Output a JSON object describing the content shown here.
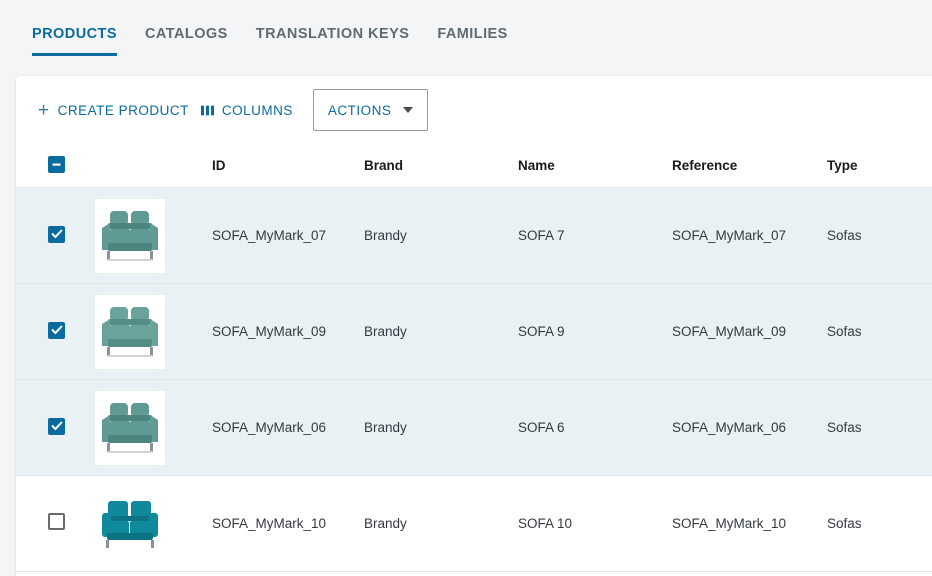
{
  "tabs": [
    {
      "label": "PRODUCTS",
      "active": true
    },
    {
      "label": "CATALOGS",
      "active": false
    },
    {
      "label": "TRANSLATION KEYS",
      "active": false
    },
    {
      "label": "FAMILIES",
      "active": false
    }
  ],
  "toolbar": {
    "create_label": "CREATE PRODUCT",
    "columns_label": "COLUMNS",
    "actions_label": "ACTIONS",
    "plus_glyph": "+"
  },
  "table": {
    "headers": {
      "id": "ID",
      "brand": "Brand",
      "name": "Name",
      "reference": "Reference",
      "type": "Type"
    },
    "select_all_state": "indeterminate",
    "rows": [
      {
        "selected": true,
        "id": "SOFA_MyMark_07",
        "brand": "Brandy",
        "name": "SOFA 7",
        "reference": "SOFA_MyMark_07",
        "type": "Sofas",
        "thumb_color": "#5f9a94",
        "thumb_shade": "#4d847f",
        "thumb_style": "armchair"
      },
      {
        "selected": true,
        "id": "SOFA_MyMark_09",
        "brand": "Brandy",
        "name": "SOFA 9",
        "reference": "SOFA_MyMark_09",
        "type": "Sofas",
        "thumb_color": "#6aa39c",
        "thumb_shade": "#548d86",
        "thumb_style": "armchair"
      },
      {
        "selected": true,
        "id": "SOFA_MyMark_06",
        "brand": "Brandy",
        "name": "SOFA 6",
        "reference": "SOFA_MyMark_06",
        "type": "Sofas",
        "thumb_color": "#5f9a94",
        "thumb_shade": "#4d847f",
        "thumb_style": "armchair"
      },
      {
        "selected": false,
        "id": "SOFA_MyMark_10",
        "brand": "Brandy",
        "name": "SOFA 10",
        "reference": "SOFA_MyMark_10",
        "type": "Sofas",
        "thumb_color": "#10899c",
        "thumb_shade": "#0c7383",
        "thumb_style": "loveseat"
      }
    ]
  },
  "colors": {
    "accent": "#0a6c9e",
    "page_background": "#f4f5f6",
    "card_background": "#ffffff",
    "selected_row": "#eaf1f4",
    "header_text": "#1a1a1a",
    "tab_inactive": "#5f6b73"
  }
}
